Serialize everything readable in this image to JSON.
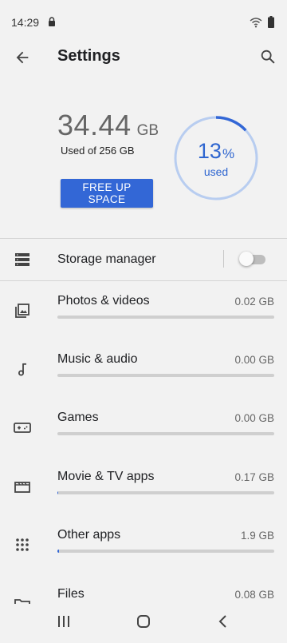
{
  "status_bar": {
    "time": "14:29"
  },
  "header": {
    "title": "Settings"
  },
  "storage": {
    "used_amount": "34.44",
    "used_unit": "GB",
    "used_of": "Used of 256 GB",
    "used_fraction": 0.13,
    "percent_value": "13",
    "percent_symbol": "%",
    "percent_caption": "used",
    "free_up_label": "FREE UP SPACE"
  },
  "storage_manager": {
    "label": "Storage manager",
    "enabled": false
  },
  "categories": [
    {
      "label": "Photos & videos",
      "size": "0.02 GB",
      "icon": "photo-library-icon"
    },
    {
      "label": "Music & audio",
      "size": "0.00 GB",
      "icon": "music-note-icon"
    },
    {
      "label": "Games",
      "size": "0.00 GB",
      "icon": "gamepad-icon"
    },
    {
      "label": "Movie & TV apps",
      "size": "0.17 GB",
      "icon": "movie-icon"
    },
    {
      "label": "Other apps",
      "size": "1.9 GB",
      "icon": "apps-grid-icon"
    },
    {
      "label": "Files",
      "size": "0.08 GB",
      "icon": "folder-icon"
    }
  ],
  "colors": {
    "accent": "#3367d6",
    "gauge_track": "#b8cdf0",
    "background": "#f2f2f2"
  }
}
